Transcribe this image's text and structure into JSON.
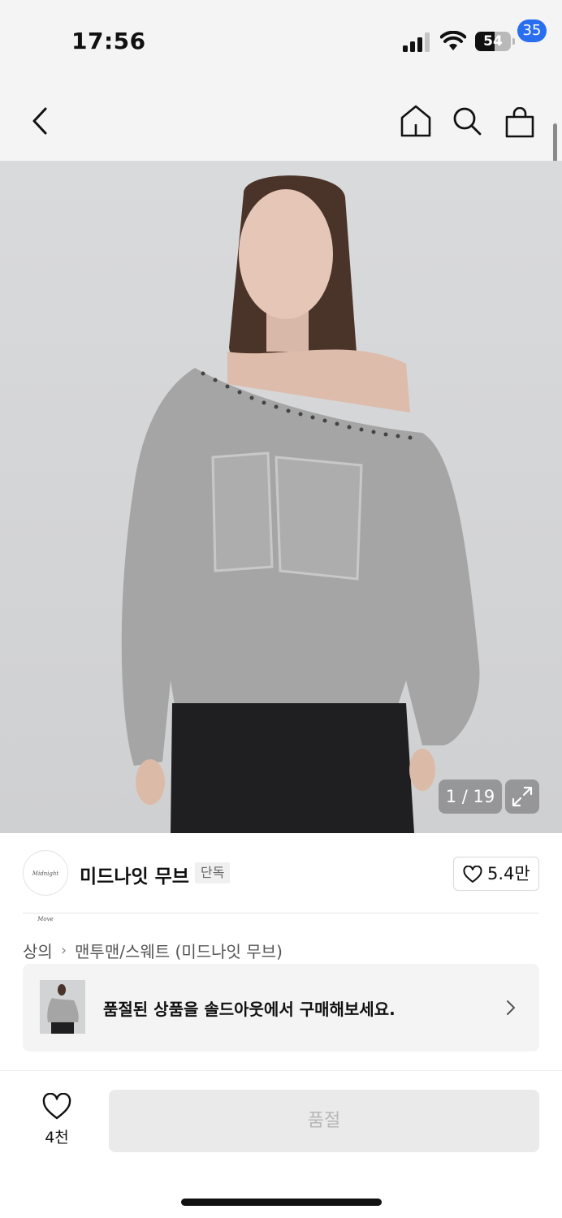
{
  "status_bar": {
    "time": "17:56",
    "battery_level": 54,
    "battery_text": "54"
  },
  "nav": {
    "cart_badge": "35"
  },
  "product": {
    "image_counter": "1 / 19",
    "image_current": 1,
    "image_total": 19
  },
  "brand": {
    "logo_text": "Midnight Move",
    "name": "미드나잇 무브",
    "badge": "단독",
    "likes": "5.4만"
  },
  "breadcrumb": {
    "level1": "상의",
    "level2": "맨투맨/스웨트 (미드나잇 무브)"
  },
  "soldout_banner": {
    "text": "품절된 상품을 솔드아웃에서 구매해보세요."
  },
  "bottom_bar": {
    "wishlist_count": "4천",
    "action_label": "품절"
  },
  "colors": {
    "badge_blue": "#2a6ef0",
    "disabled_button": "#eaeaea",
    "disabled_text": "#b7b7b7"
  }
}
